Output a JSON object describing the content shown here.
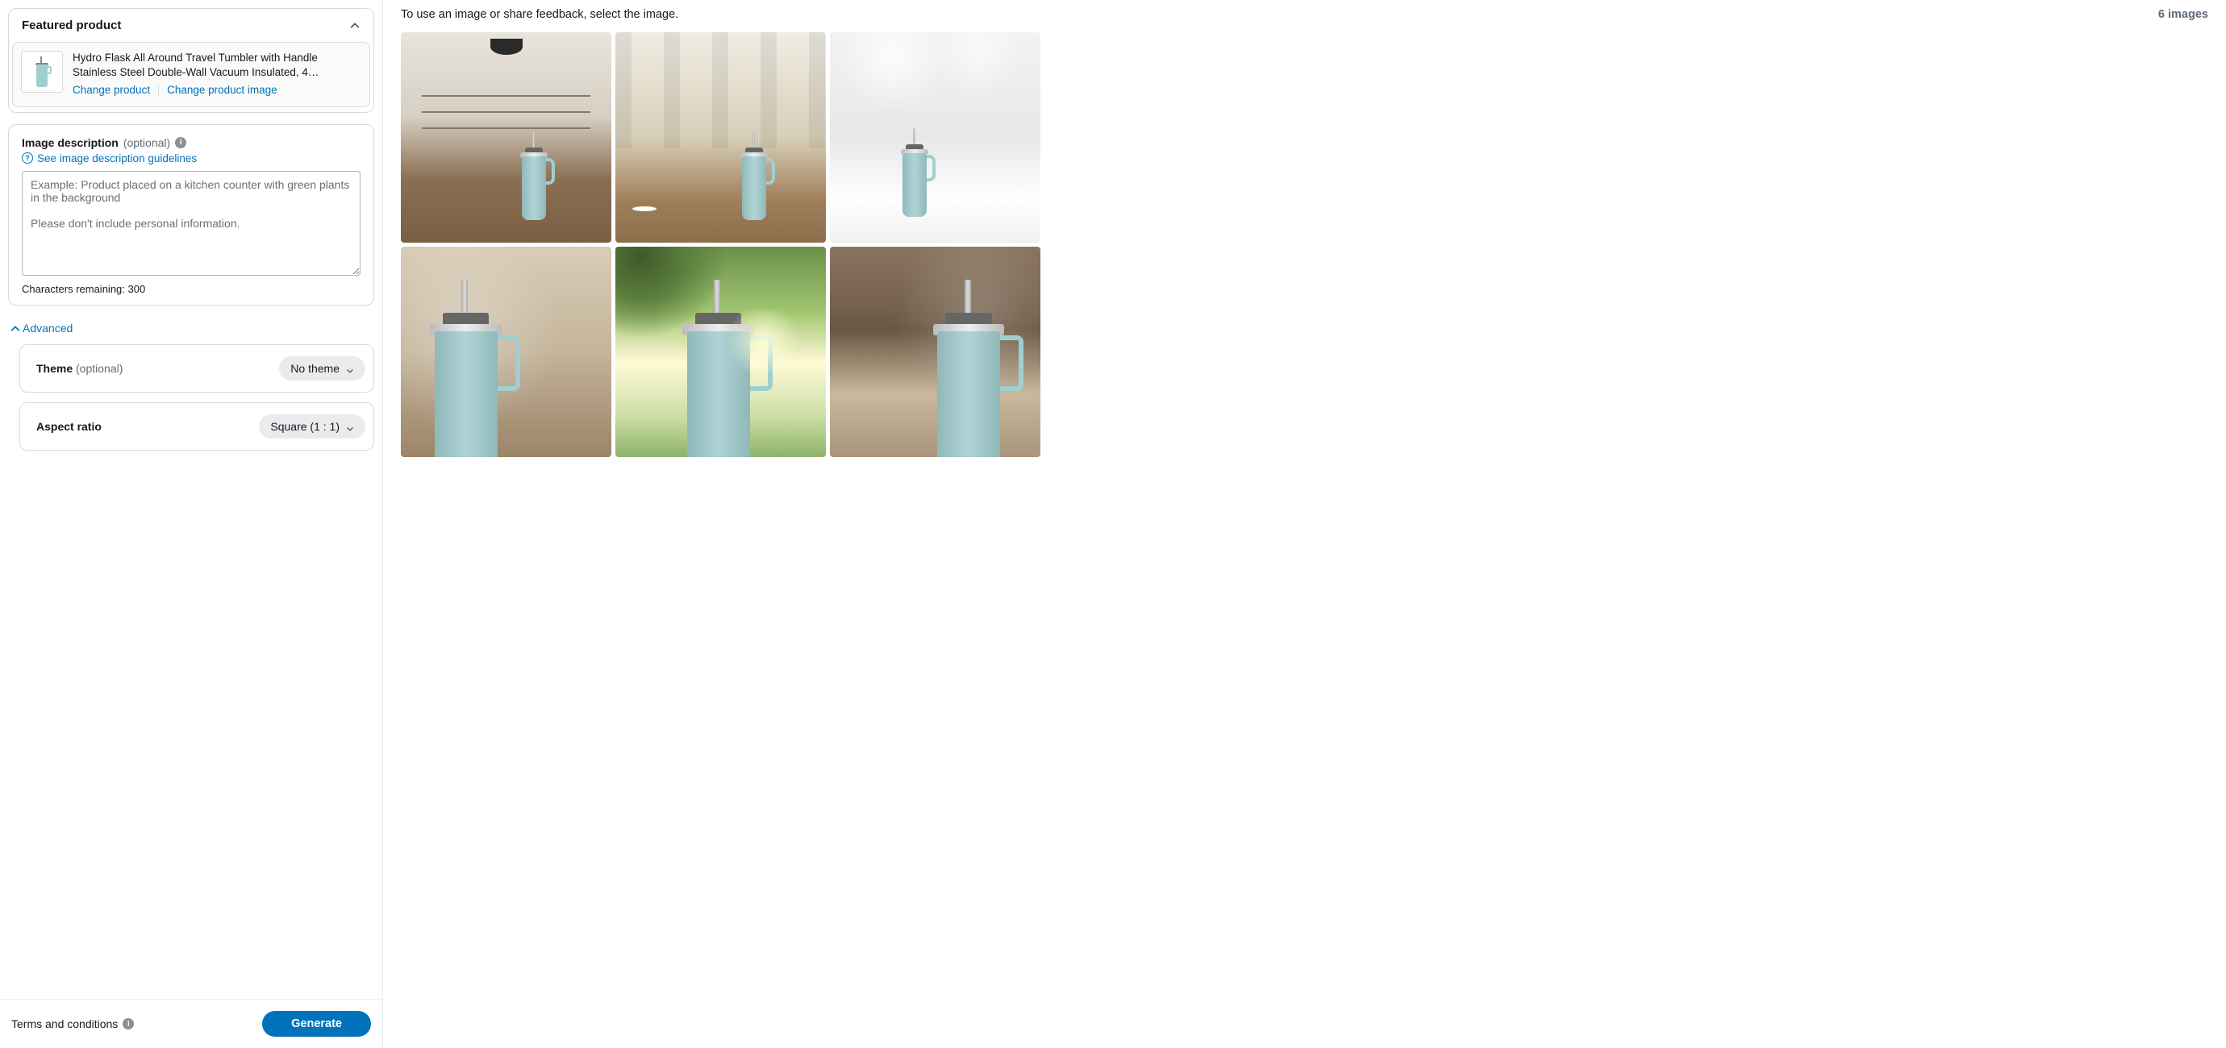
{
  "sidebar": {
    "featured_product": {
      "header": "Featured product",
      "title": "Hydro Flask All Around Travel Tumbler with Handle Stainless Steel Double-Wall Vacuum Insulated, 4…",
      "change_product": "Change product",
      "change_image": "Change product image"
    },
    "image_description": {
      "label": "Image description",
      "optional": "(optional)",
      "guidelines_link": "See image description guidelines",
      "placeholder": "Example: Product placed on a kitchen counter with green plants in the background\n\nPlease don't include personal information.",
      "value": "",
      "char_remaining": "Characters remaining: 300"
    },
    "advanced": {
      "toggle": "Advanced",
      "theme_label": "Theme",
      "theme_optional": "(optional)",
      "theme_value": "No theme",
      "aspect_label": "Aspect ratio",
      "aspect_value": "Square (1 : 1)"
    },
    "footer": {
      "terms": "Terms and conditions",
      "generate": "Generate"
    }
  },
  "main": {
    "instruction": "To use an image or share feedback, select the image.",
    "count": "6 images"
  }
}
